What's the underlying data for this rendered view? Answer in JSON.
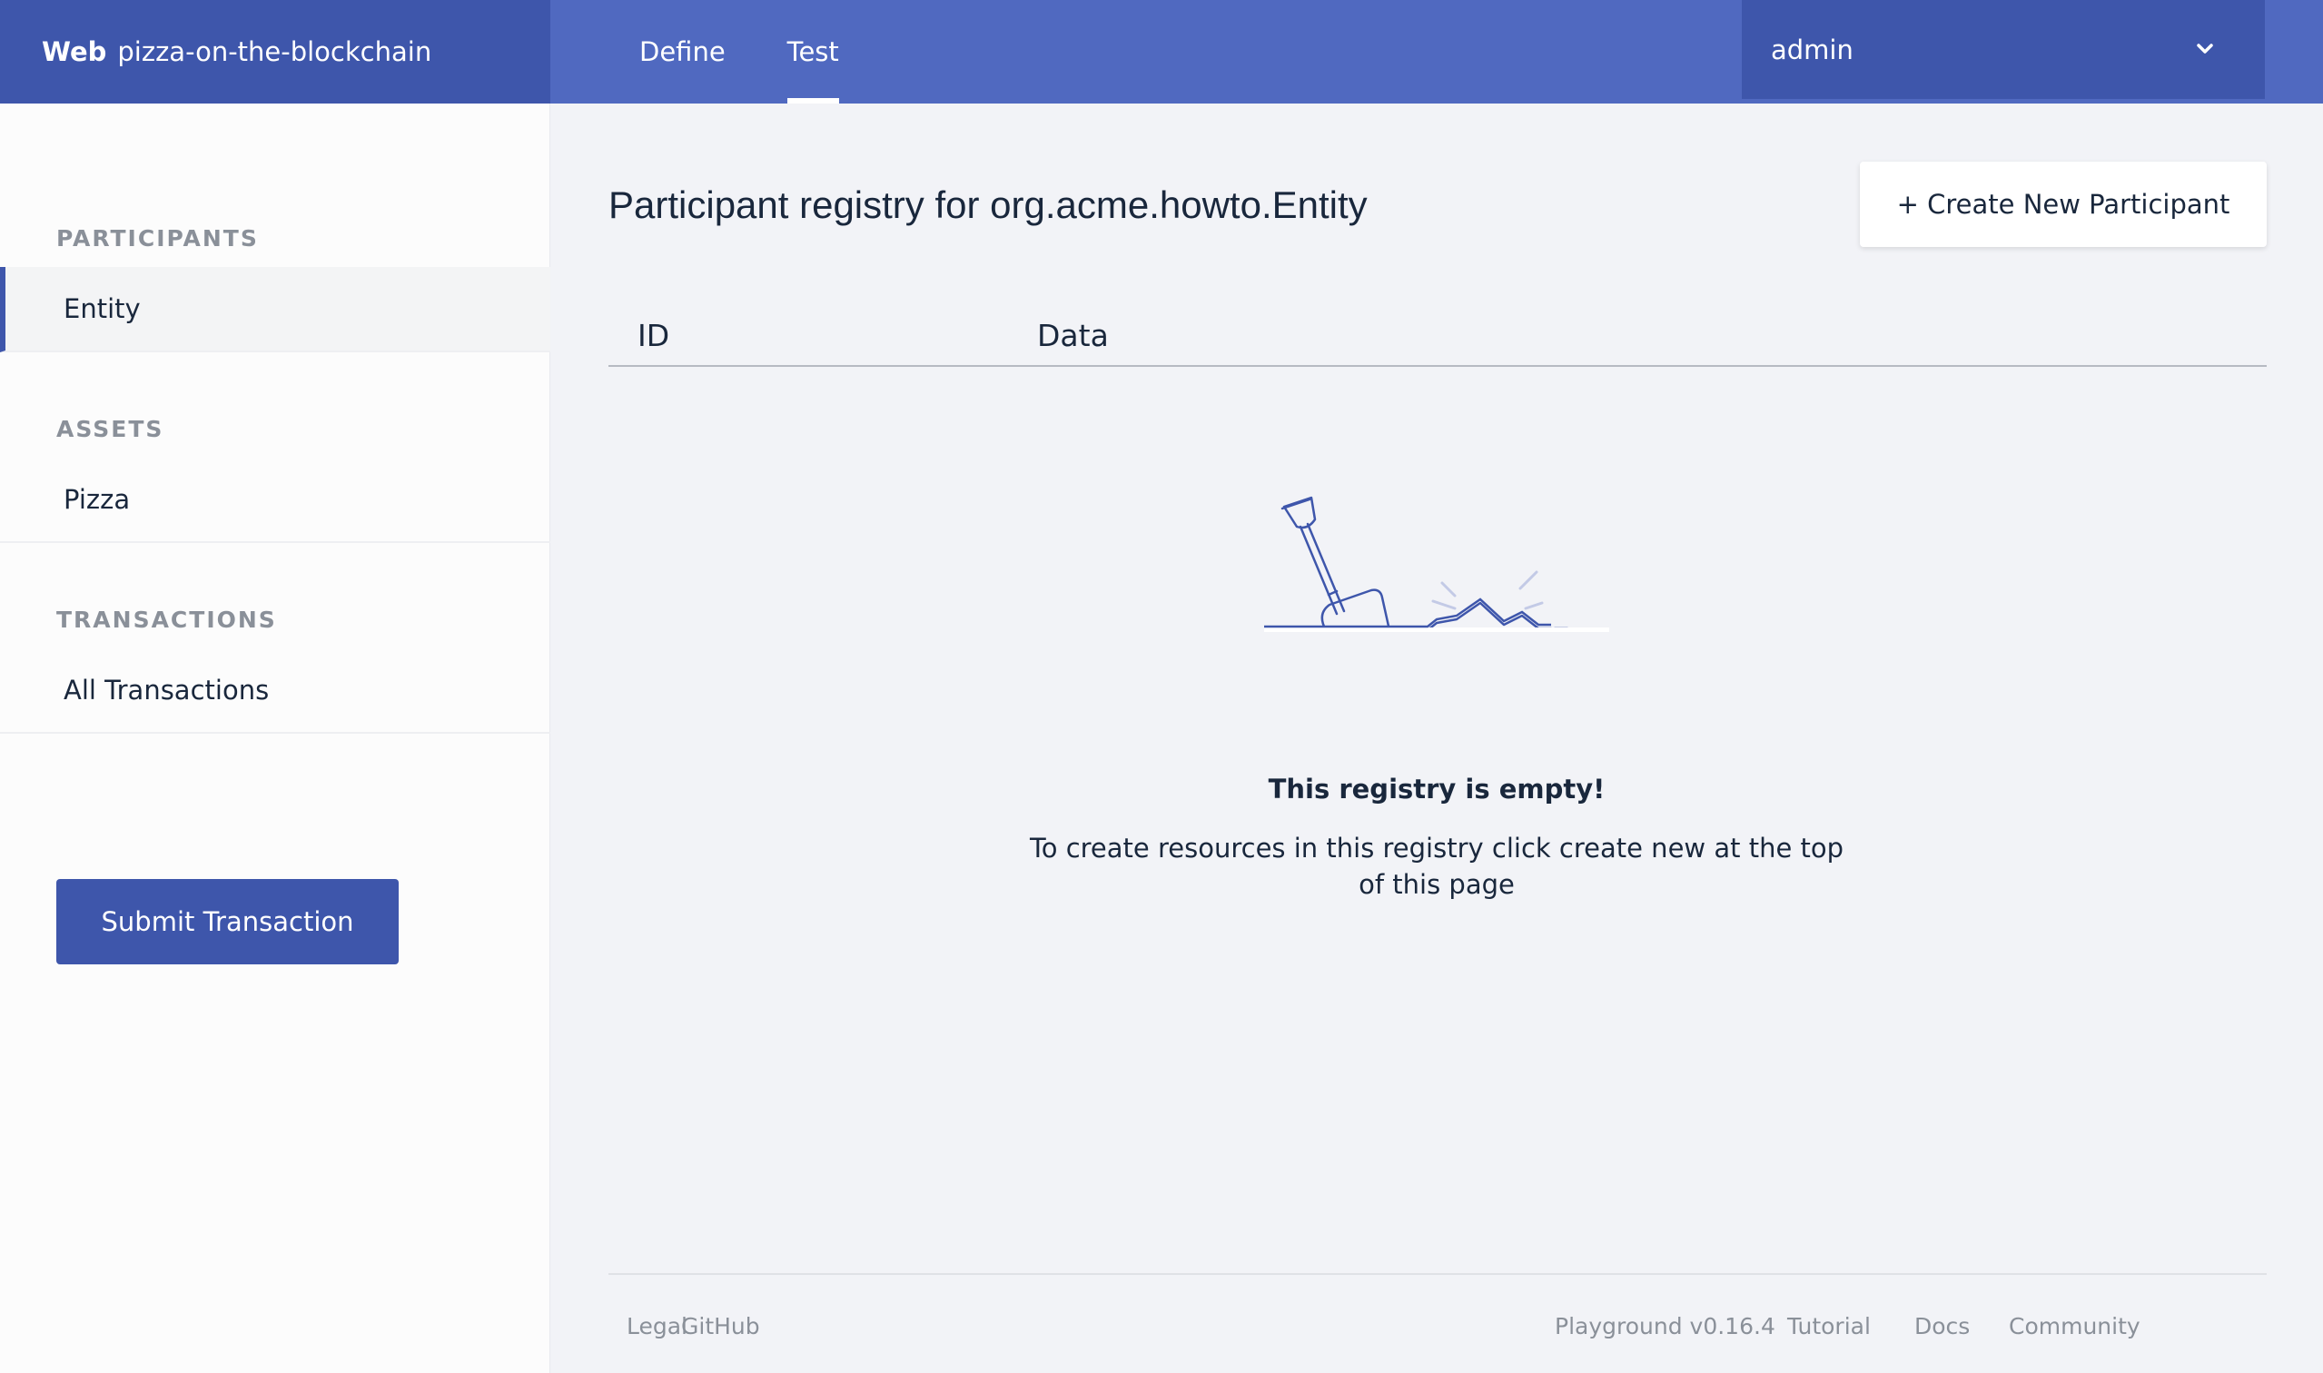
{
  "app": {
    "brand_bold": "Web",
    "brand_name": "pizza-on-the-blockchain"
  },
  "nav": {
    "tabs": [
      {
        "label": "Define",
        "active": false
      },
      {
        "label": "Test",
        "active": true
      }
    ],
    "user": "admin",
    "user_icon": "chevron-down-icon"
  },
  "sidebar": {
    "participants_title": "PARTICIPANTS",
    "participants": [
      {
        "label": "Entity",
        "active": true
      }
    ],
    "assets_title": "ASSETS",
    "assets": [
      {
        "label": "Pizza"
      }
    ],
    "transactions_title": "TRANSACTIONS",
    "transactions": [
      {
        "label": "All Transactions"
      }
    ],
    "submit_label": "Submit Transaction"
  },
  "main": {
    "heading": "Participant registry for org.acme.howto.Entity",
    "create_label": "+ Create New Participant",
    "columns": [
      "ID",
      "Data"
    ],
    "empty_icon": "shovel-icon",
    "empty_title": "This registry is empty!",
    "empty_text": "To create resources in this registry click create new at the top of this page"
  },
  "footer": {
    "left": [
      "Legal",
      "GitHub"
    ],
    "right": [
      "Playground v0.16.4",
      "Tutorial",
      "Docs",
      "Community"
    ]
  },
  "colors": {
    "primary": "#3e56ab",
    "topbar": "#5069c0",
    "background": "#f2f3f7"
  }
}
